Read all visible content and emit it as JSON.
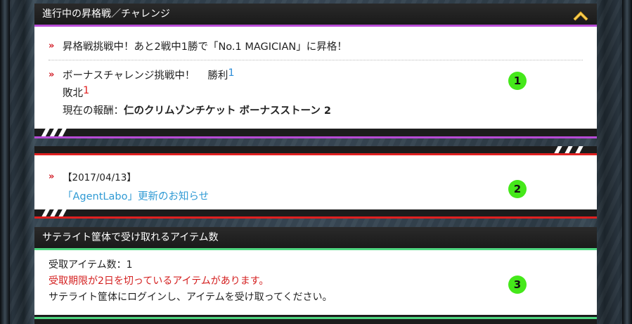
{
  "panel1": {
    "title": "進行中の昇格戦／チャレンジ",
    "promo_text": "昇格戦挑戦中！あと2戦中1勝で「No.1 MAGICIAN」に昇格！",
    "bonus_label": "ボーナスチャレンジ挑戦中！",
    "win_label": "勝利",
    "win_count": "1",
    "lose_label": "敗北",
    "lose_count": "1",
    "reward_label": "現在の報酬：",
    "reward_value": "仁のクリムゾンチケット ボーナスストーン 2",
    "badge": "1"
  },
  "panel2": {
    "date": "【2017/04/13】",
    "news_link": "「AgentLabo」更新のお知らせ",
    "badge": "2"
  },
  "panel3": {
    "title": "サテライト筐体で受け取れるアイテム数",
    "count_line": "受取アイテム数：1",
    "warning_line": "受取期限が2日を切っているアイテムがあります。",
    "info_line": "サテライト筐体にログインし、アイテムを受け取ってください。",
    "badge": "3"
  },
  "colors": {
    "accent_purple": "#b84bd6",
    "accent_red": "#e02020",
    "accent_green": "#4fd681",
    "badge_green": "#45e81a",
    "link_blue": "#2f9ad4",
    "toggle_gold": "#e8b020"
  },
  "icons": {
    "toggle": "chevron-up-icon",
    "bullet": "double-chevron-right-icon"
  }
}
